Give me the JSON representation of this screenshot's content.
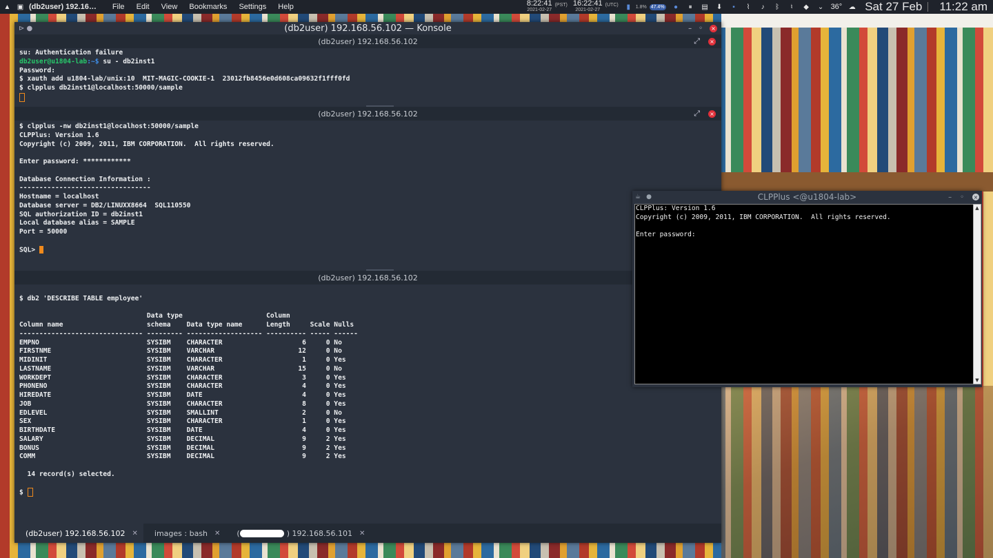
{
  "panel": {
    "app_title": "(db2user) 192.16…",
    "menu": [
      "File",
      "Edit",
      "View",
      "Bookmarks",
      "Settings",
      "Help"
    ],
    "clock_local_time": "8:22:41",
    "clock_local_date": "2021-02-27",
    "clock_local_zone": "(PST)",
    "clock_utc_time": "16:22:41",
    "clock_utc_date": "2021-02-27",
    "clock_utc_zone": "(UTC)",
    "cpu": "1.8%",
    "mem": "47.4%",
    "temperature": "36°",
    "date": "Sat 27 Feb",
    "time": "11:22 am"
  },
  "konsole": {
    "window_title": "(db2user) 192.168.56.102 — Konsole",
    "pane1": {
      "title": "(db2user) 192.168.56.102",
      "lines": [
        "su: Authentication failure",
        "",
        "Password:",
        "$ xauth add u1804-lab/unix:10  MIT-MAGIC-COOKIE-1  23012fb8456e0d608ca09632f1fff0fd",
        "$ clpplus db2inst1@localhost:50000/sample"
      ],
      "prompt_user": "db2user@u1804-lab",
      "prompt_path": ":~$ ",
      "prompt_cmd": "su - db2inst1"
    },
    "pane2": {
      "title": "(db2user) 192.168.56.102",
      "text": "$ clpplus -nw db2inst1@localhost:50000/sample\nCLPPlus: Version 1.6\nCopyright (c) 2009, 2011, IBM CORPORATION.  All rights reserved.\n\nEnter password: ************\n\nDatabase Connection Information :\n---------------------------------\nHostname = localhost\nDatabase server = DB2/LINUXX8664  SQL110550\nSQL authorization ID = db2inst1\nLocal database alias = SAMPLE\nPort = 50000\n\n",
      "sql_prompt": "SQL> "
    },
    "pane3": {
      "title": "(db2user) 192.168.56.102",
      "text": "\n$ db2 'DESCRIBE TABLE employee'\n\n                                Data type                     Column\nColumn name                     schema    Data type name      Length     Scale Nulls\n------------------------------- --------- ------------------- ---------- ----- ------\nEMPNO                           SYSIBM    CHARACTER                    6     0 No\nFIRSTNME                        SYSIBM    VARCHAR                     12     0 No\nMIDINIT                         SYSIBM    CHARACTER                    1     0 Yes\nLASTNAME                        SYSIBM    VARCHAR                     15     0 No\nWORKDEPT                        SYSIBM    CHARACTER                    3     0 Yes\nPHONENO                         SYSIBM    CHARACTER                    4     0 Yes\nHIREDATE                        SYSIBM    DATE                         4     0 Yes\nJOB                             SYSIBM    CHARACTER                    8     0 Yes\nEDLEVEL                         SYSIBM    SMALLINT                     2     0 No\nSEX                             SYSIBM    CHARACTER                    1     0 Yes\nBIRTHDATE                       SYSIBM    DATE                         4     0 Yes\nSALARY                          SYSIBM    DECIMAL                      9     2 Yes\nBONUS                           SYSIBM    DECIMAL                      9     2 Yes\nCOMM                            SYSIBM    DECIMAL                      9     2 Yes\n\n  14 record(s) selected.\n\n",
      "shell_prompt": "$ "
    },
    "tabs": [
      {
        "label": "(db2user) 192.168.56.102",
        "active": true
      },
      {
        "label": "images : bash",
        "active": false
      },
      {
        "label": ") 192.168.56.101",
        "active": false
      }
    ]
  },
  "clpplus": {
    "window_title": "CLPPlus <@u1804-lab>",
    "text": "CLPPlus: Version 1.6\nCopyright (c) 2009, 2011, IBM CORPORATION.  All rights reserved.\n\nEnter password:"
  }
}
